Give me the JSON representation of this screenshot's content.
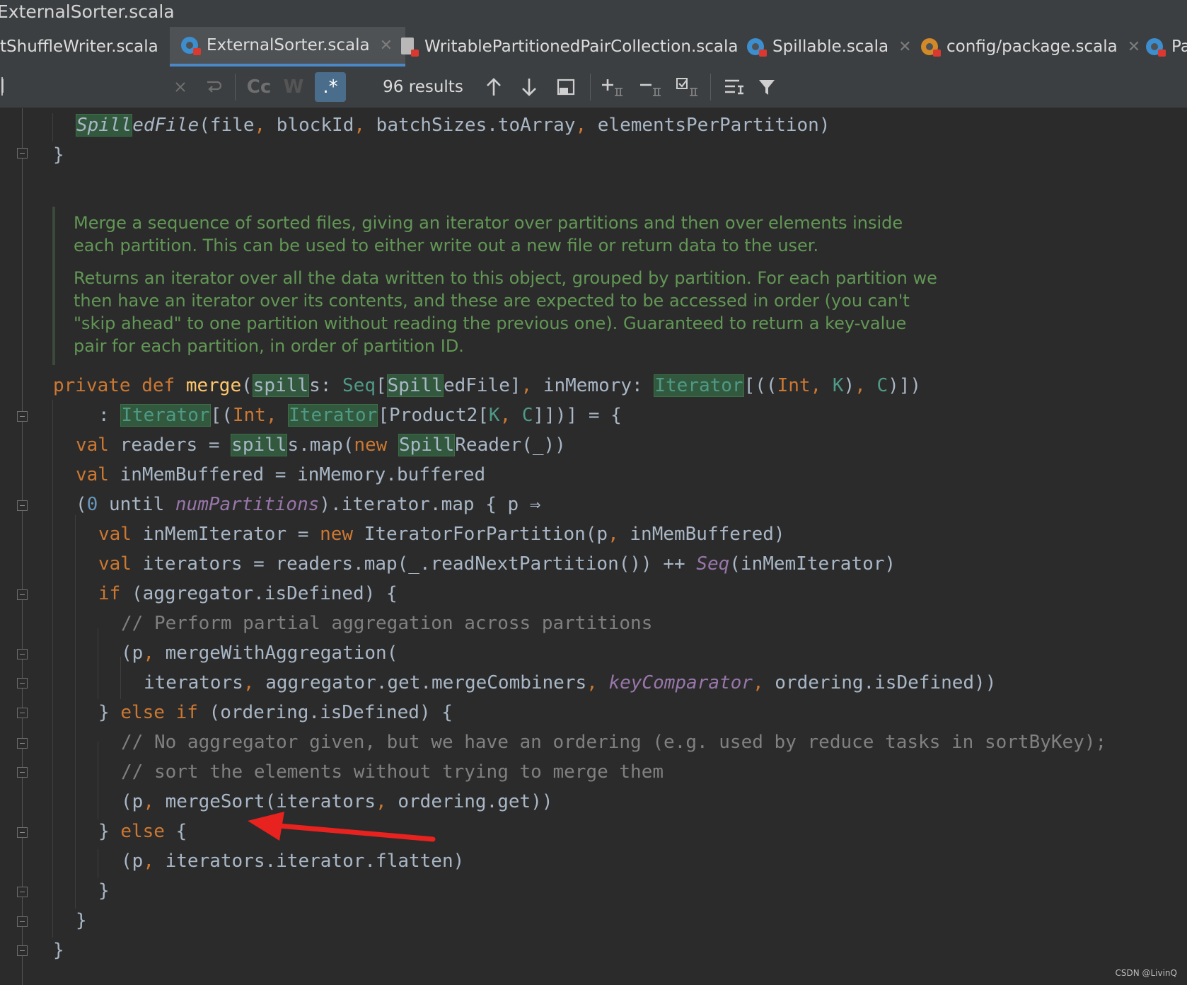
{
  "window": {
    "title": "ExternalSorter.scala"
  },
  "tabs": [
    {
      "label": "tShuffleWriter.scala",
      "icon": "none"
    },
    {
      "label": "ExternalSorter.scala",
      "icon": "scala-class-icon",
      "active": true
    },
    {
      "label": "WritablePartitionedPairCollection.scala",
      "icon": "scala-trait-icon"
    },
    {
      "label": "Spillable.scala",
      "icon": "scala-class-icon"
    },
    {
      "label": "config/package.scala",
      "icon": "scala-package-icon"
    },
    {
      "label": "Pa",
      "icon": "scala-class-icon"
    }
  ],
  "tab_close_glyph": "✕",
  "find": {
    "query": "l",
    "results": "96 results",
    "match_case_label": "Cc",
    "words_label": "W",
    "regex_label": ".*",
    "regex_active": true
  },
  "doc": {
    "para1_line1": "Merge a sequence of sorted files, giving an iterator over partitions and then over elements inside",
    "para1_line2": "each partition. This can be used to either write out a new file or return data to the user.",
    "para2_line1": "Returns an iterator over all the data written to this object, grouped by partition. For each partition we",
    "para2_line2": "then have an iterator over its contents, and these are expected to be accessed in order (you can't",
    "para2_line3": "\"skip ahead\" to one partition without reading the previous one). Guaranteed to return a key-value",
    "para2_line4": "pair for each partition, in order of partition ID."
  },
  "code": {
    "c1": "// Perform partial aggregation across partitions",
    "c2": "// No aggregator given, but we have an ordering (e.g. used by reduce tasks in sortByKey);",
    "c3": "// sort the elements without trying to merge them"
  },
  "colors": {
    "background": "#2b2b2b",
    "keyword": "#cc7832",
    "type": "#4e9a87",
    "doc_comment": "#629755",
    "line_comment": "#808080",
    "search_highlight": "#32593d",
    "annotation_arrow": "#e8221e"
  },
  "watermark": "CSDN @LivinQ"
}
